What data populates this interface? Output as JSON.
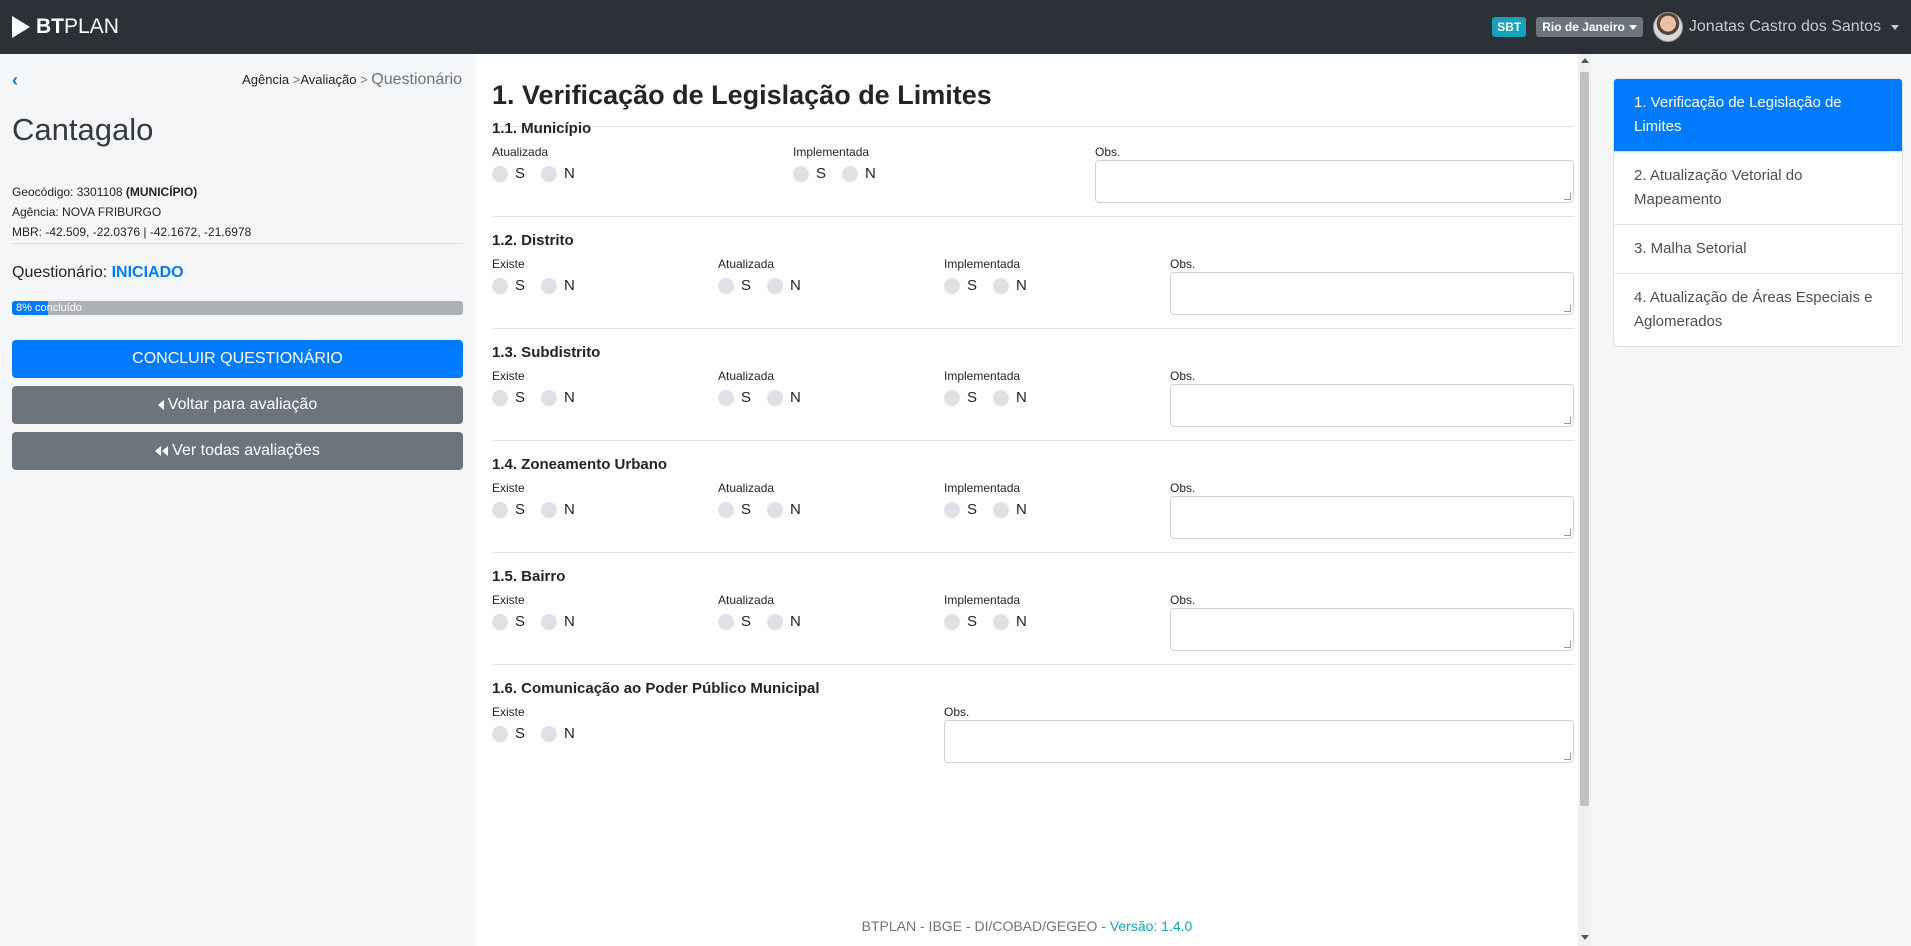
{
  "navbar": {
    "brand_bold": "BT",
    "brand_rest": "PLAN",
    "badge": "SBT",
    "region": "Rio de Janeiro",
    "user_name": "Jonatas Castro dos Santos"
  },
  "left": {
    "breadcrumb": {
      "item1": "Agência",
      "sep1": " >",
      "item2": "Avaliação",
      "sep2": " > ",
      "current": "Questionário"
    },
    "city": "Cantagalo",
    "geocodigo_label": "Geocódigo: 3301108 ",
    "geocodigo_type": "(MUNICÍPIO)",
    "agencia": "Agência: NOVA FRIBURGO",
    "mbr": "MBR: -42.509, -22.0376 | -42.1672, -21.6978",
    "status_label": "Questionário: ",
    "status_value": "INICIADO",
    "progress": {
      "percent": 8,
      "label": "8% concluído"
    },
    "btn_concluir": "CONCLUIR QUESTIONÁRIO",
    "btn_voltar": "Voltar para avaliação",
    "btn_ver_todas": "Ver todas avaliações"
  },
  "form": {
    "title": "1. Verificação de Legislação de Limites",
    "options": {
      "yes": "S",
      "no": "N"
    },
    "obs_label": "Obs.",
    "sections": [
      {
        "title": "1.1. Município",
        "fields": [
          "Atualizada",
          "Implementada"
        ]
      },
      {
        "title": "1.2. Distrito",
        "fields": [
          "Existe",
          "Atualizada",
          "Implementada"
        ]
      },
      {
        "title": "1.3. Subdistrito",
        "fields": [
          "Existe",
          "Atualizada",
          "Implementada"
        ]
      },
      {
        "title": "1.4. Zoneamento Urbano",
        "fields": [
          "Existe",
          "Atualizada",
          "Implementada"
        ]
      },
      {
        "title": "1.5. Bairro",
        "fields": [
          "Existe",
          "Atualizada",
          "Implementada"
        ]
      },
      {
        "title": "1.6. Comunicação ao Poder Público Municipal",
        "fields": [
          "Existe"
        ]
      }
    ]
  },
  "footer": {
    "text": "BTPLAN - IBGE - DI/COBAD/GEGEO - ",
    "version": "Versão: 1.4.0"
  },
  "sidebar": {
    "items": [
      {
        "label": "1. Verificação de Legislação de Limites",
        "active": true
      },
      {
        "label": "2. Atualização Vetorial do Mapeamento",
        "active": false
      },
      {
        "label": "3. Malha Setorial",
        "active": false
      },
      {
        "label": "4. Atualização de Áreas Especiais e Aglomerados",
        "active": false
      }
    ]
  }
}
